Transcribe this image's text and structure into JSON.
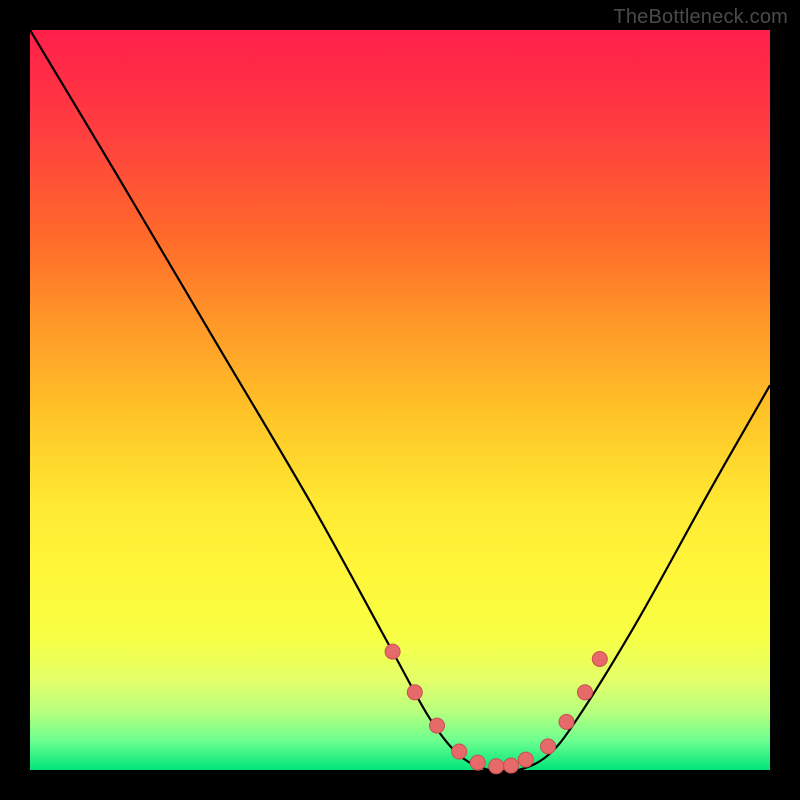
{
  "attribution": "TheBottleneck.com",
  "colors": {
    "curve": "#000000",
    "marker_fill": "#e76a6a",
    "marker_stroke": "#c94f4f"
  },
  "chart_data": {
    "type": "line",
    "title": "",
    "xlabel": "",
    "ylabel": "",
    "xlim": [
      0,
      100
    ],
    "ylim": [
      0,
      100
    ],
    "series": [
      {
        "name": "bottleneck-curve",
        "x": [
          0,
          12,
          25,
          38,
          49,
          54,
          58,
          62,
          66,
          70,
          74,
          82,
          92,
          100
        ],
        "y": [
          100,
          80,
          58,
          36,
          16,
          7,
          2,
          0,
          0,
          2,
          7,
          20,
          38,
          52
        ]
      }
    ],
    "markers": {
      "name": "highlighted-points",
      "x": [
        49,
        52,
        55,
        58,
        60.5,
        63,
        65,
        67,
        70,
        72.5,
        75,
        77
      ],
      "y": [
        16,
        10.5,
        6,
        2.5,
        1,
        0.5,
        0.6,
        1.4,
        3.2,
        6.5,
        10.5,
        15
      ]
    }
  }
}
